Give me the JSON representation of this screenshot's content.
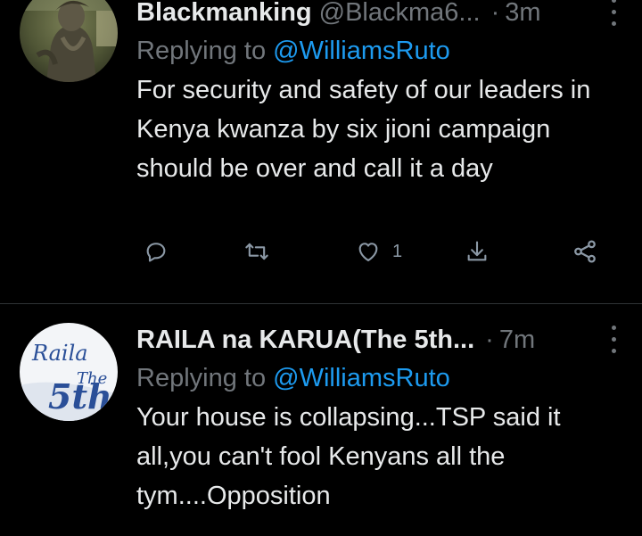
{
  "tweets": [
    {
      "name": "Blackmanking",
      "handle": "@Blackma6...",
      "separator": "·",
      "time": "3m",
      "replying_prefix": "Replying to",
      "replying_to": "@WilliamsRuto",
      "body": "For security and safety of our leaders in Kenya kwanza by six jioni campaign should be over and call it a day",
      "actions": {
        "reply_icon": "reply-icon",
        "retweet_icon": "retweet-icon",
        "like_icon": "heart-icon",
        "like_count": "1",
        "bookmark_icon": "download-icon",
        "share_icon": "share-icon"
      }
    },
    {
      "name": "RAILA na KARUA(The 5th...",
      "handle": "",
      "separator": "·",
      "time": "7m",
      "replying_prefix": "Replying to",
      "replying_to": "@WilliamsRuto",
      "body": "Your house is collapsing...TSP said it all,you can't fool Kenyans all the tym....Opposition",
      "avatar_text": [
        "Raila",
        "The",
        "5th"
      ]
    }
  ],
  "colors": {
    "background": "#000000",
    "text": "#e7e9ea",
    "secondary": "#71767b",
    "link": "#1d9bf0",
    "divider": "#2f3336"
  }
}
